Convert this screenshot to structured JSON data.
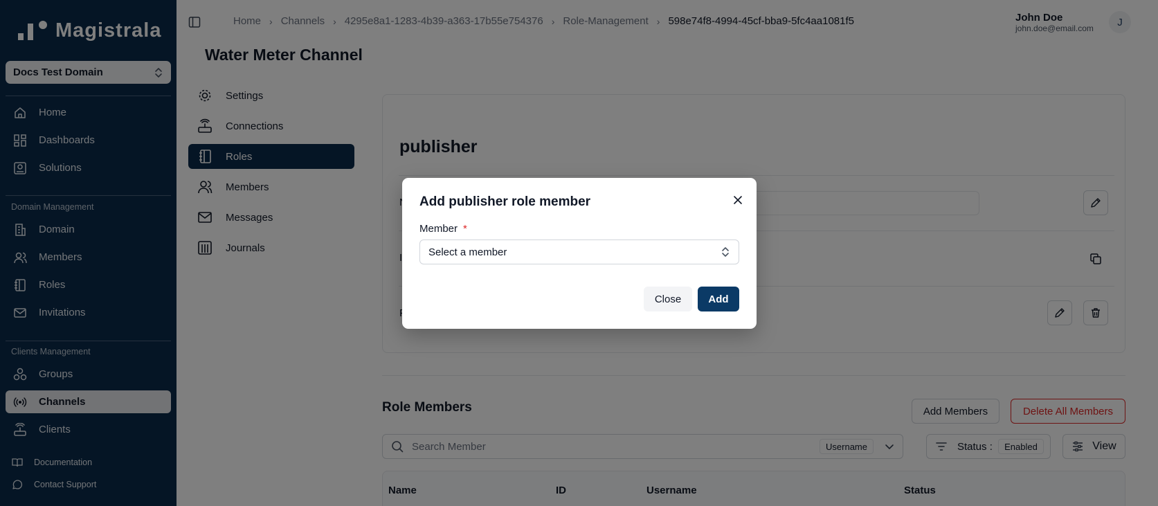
{
  "app": {
    "name": "Magistrala"
  },
  "sidebar": {
    "domain_selector": "Docs Test Domain",
    "top_items": [
      {
        "label": "Home",
        "icon": "home-icon"
      },
      {
        "label": "Dashboards",
        "icon": "dashboard-icon"
      },
      {
        "label": "Solutions",
        "icon": "solutions-icon"
      }
    ],
    "domain_management_label": "Domain Management",
    "domain_items": [
      {
        "label": "Domain",
        "icon": "building-icon"
      },
      {
        "label": "Members",
        "icon": "users-icon"
      },
      {
        "label": "Roles",
        "icon": "notebook-icon"
      },
      {
        "label": "Invitations",
        "icon": "mail-icon"
      }
    ],
    "clients_management_label": "Clients Management",
    "client_items": [
      {
        "label": "Groups",
        "icon": "groups-icon"
      },
      {
        "label": "Channels",
        "icon": "radio-icon",
        "active": true
      },
      {
        "label": "Clients",
        "icon": "router-icon"
      }
    ],
    "footer_items": [
      {
        "label": "Documentation",
        "icon": "book-icon"
      },
      {
        "label": "Contact Support",
        "icon": "chat-icon"
      }
    ]
  },
  "breadcrumb": [
    "Home",
    "Channels",
    "4295e8a1-1283-4b39-a363-17b55e754376",
    "Role-Management",
    "598e74f8-4994-45cf-bba9-5fc4aa1081f5"
  ],
  "user": {
    "name": "John Doe",
    "email": "john.doe@email.com",
    "initial": "J"
  },
  "page": {
    "title": "Water Meter Channel"
  },
  "subnav": [
    {
      "label": "Settings",
      "icon": "gear-icon"
    },
    {
      "label": "Connections",
      "icon": "router-icon"
    },
    {
      "label": "Roles",
      "icon": "notebook-icon",
      "active": true
    },
    {
      "label": "Members",
      "icon": "users-icon"
    },
    {
      "label": "Messages",
      "icon": "mail-icon"
    },
    {
      "label": "Journals",
      "icon": "journal-icon"
    }
  ],
  "role": {
    "name": "publisher",
    "row_labels": [
      "N",
      "I",
      "F"
    ]
  },
  "role_members": {
    "title": "Role Members",
    "add_button": "Add Members",
    "delete_all_button": "Delete All Members",
    "search_placeholder": "Search Member",
    "search_field_chip": "Username",
    "status_label": "Status :",
    "status_value": "Enabled",
    "view_button": "View",
    "columns": [
      "Name",
      "ID",
      "Username",
      "Status"
    ]
  },
  "modal": {
    "title": "Add publisher role member",
    "field_label": "Member",
    "required_mark": "*",
    "select_placeholder": "Select a member",
    "close_button": "Close",
    "add_button": "Add"
  }
}
